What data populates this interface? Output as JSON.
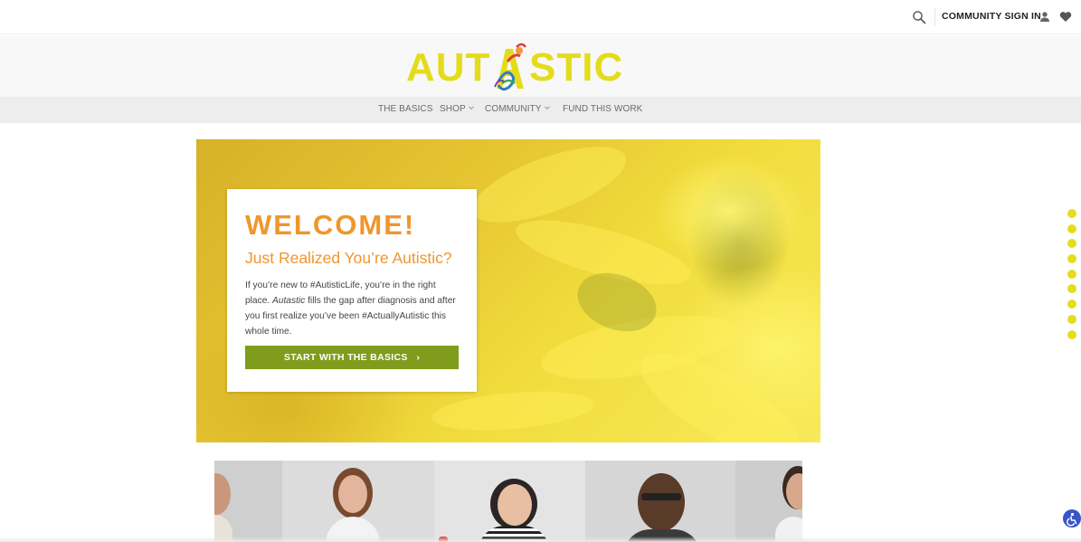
{
  "topbar": {
    "signin_label": "COMMUNITY SIGN IN",
    "icons": [
      "search-icon",
      "user-icon",
      "heart-icon"
    ]
  },
  "logo": {
    "text_left": "AUT",
    "text_right": "STIC",
    "color": "#e4dc1a"
  },
  "nav": {
    "items": [
      {
        "label": "THE BASICS",
        "has_dropdown": false
      },
      {
        "label": "SHOP",
        "has_dropdown": true
      },
      {
        "label": "COMMUNITY",
        "has_dropdown": true
      },
      {
        "label": "FUND THIS WORK",
        "has_dropdown": false
      }
    ]
  },
  "hero": {
    "heading": "WELCOME!",
    "subheading": "Just Realized You’re Autistic?",
    "body_1": "If you’re new to #AutisticLife, you’re in the right place. ",
    "body_em": "Autastic",
    "body_2": " fills the gap after diagnosis and after you first realize you’ve been #ActuallyAutistic this whole time.",
    "button_label": "START WITH THE BASICS",
    "button_chevron": "›",
    "accent_color": "#f0962d",
    "button_color": "#7f9c1c"
  },
  "scroll_dots": {
    "count": 9,
    "color": "#e5dd1c"
  },
  "photo_strip": {
    "panels": 5
  },
  "accessibility": {
    "icon": "accessibility-icon",
    "color": "#3a55c7"
  }
}
